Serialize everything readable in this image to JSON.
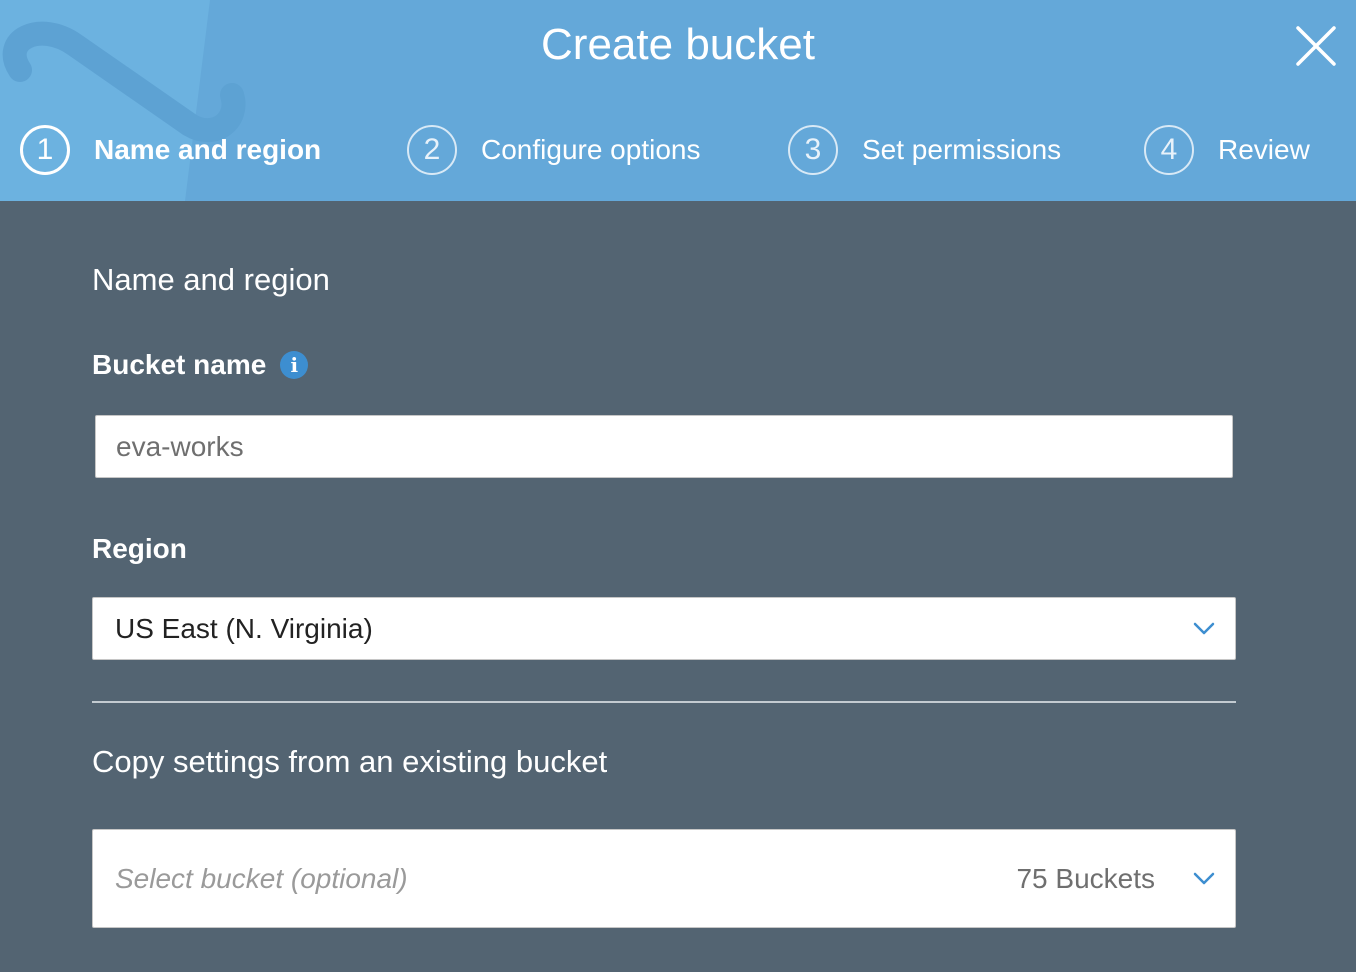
{
  "dialog": {
    "title": "Create bucket",
    "close_icon": "close-icon"
  },
  "steps": [
    {
      "number": "1",
      "label": "Name and region",
      "active": true
    },
    {
      "number": "2",
      "label": "Configure options",
      "active": false
    },
    {
      "number": "3",
      "label": "Set permissions",
      "active": false
    },
    {
      "number": "4",
      "label": "Review",
      "active": false
    }
  ],
  "form": {
    "section_title": "Name and region",
    "bucket_name": {
      "label": "Bucket name",
      "info_icon": "info-icon",
      "value": "eva-works"
    },
    "region": {
      "label": "Region",
      "selected": "US East (N. Virginia)",
      "chevron_icon": "chevron-down-icon"
    }
  },
  "copy_settings": {
    "title": "Copy settings from an existing bucket",
    "placeholder": "Select bucket (optional)",
    "count": "75 Buckets",
    "chevron_icon": "chevron-down-icon"
  },
  "colors": {
    "header_bg": "#64a8d9",
    "body_bg": "#536472",
    "accent": "#3d8ed0"
  }
}
